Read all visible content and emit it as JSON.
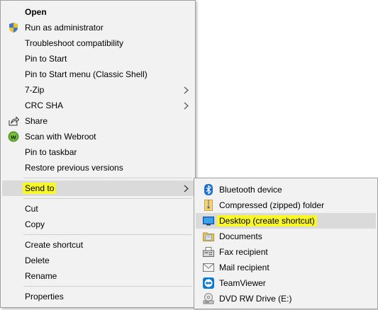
{
  "context_menu": {
    "items": [
      {
        "label": "Open",
        "icon": ""
      },
      {
        "label": "Run as administrator",
        "icon": "uac-shield-icon"
      },
      {
        "label": "Troubleshoot compatibility",
        "icon": ""
      },
      {
        "label": "Pin to Start",
        "icon": ""
      },
      {
        "label": "Pin to Start menu (Classic Shell)",
        "icon": ""
      },
      {
        "label": "7-Zip",
        "icon": "",
        "submenu": true
      },
      {
        "label": "CRC SHA",
        "icon": "",
        "submenu": true
      },
      {
        "label": "Share",
        "icon": "share-icon"
      },
      {
        "label": "Scan with Webroot",
        "icon": "webroot-icon"
      },
      {
        "label": "Pin to taskbar",
        "icon": ""
      },
      {
        "label": "Restore previous versions",
        "icon": ""
      },
      {
        "label": "Send to",
        "icon": "",
        "submenu": true,
        "highlighted": true
      },
      {
        "label": "Cut",
        "icon": ""
      },
      {
        "label": "Copy",
        "icon": ""
      },
      {
        "label": "Create shortcut",
        "icon": ""
      },
      {
        "label": "Delete",
        "icon": ""
      },
      {
        "label": "Rename",
        "icon": ""
      },
      {
        "label": "Properties",
        "icon": ""
      }
    ]
  },
  "send_to_menu": {
    "items": [
      {
        "label": "Bluetooth device",
        "icon": "bluetooth-icon"
      },
      {
        "label": "Compressed (zipped) folder",
        "icon": "zip-folder-icon"
      },
      {
        "label": "Desktop (create shortcut)",
        "icon": "desktop-icon",
        "highlighted": true
      },
      {
        "label": "Documents",
        "icon": "documents-icon"
      },
      {
        "label": "Fax recipient",
        "icon": "fax-icon"
      },
      {
        "label": "Mail recipient",
        "icon": "mail-icon"
      },
      {
        "label": "TeamViewer",
        "icon": "teamviewer-icon"
      },
      {
        "label": "DVD RW Drive (E:)",
        "icon": "dvd-drive-icon"
      }
    ]
  },
  "colors": {
    "highlight_marker": "#f7f72a",
    "hover_row": "#dadada",
    "menu_bg": "#f2f2f2"
  }
}
